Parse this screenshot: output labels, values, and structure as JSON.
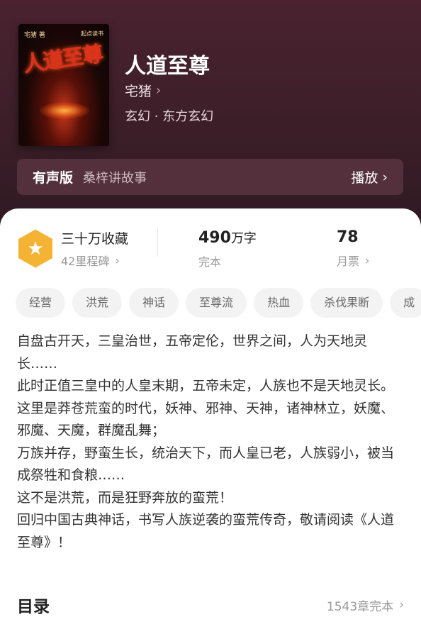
{
  "book": {
    "title": "人道至尊",
    "author": "宅猪",
    "genre": "玄幻 · 东方玄幻",
    "cover": {
      "author_mark": "宅猪 著",
      "publisher_mark": "起点读书",
      "title_art": "人道至尊"
    }
  },
  "audio": {
    "label": "有声版",
    "narrator": "桑梓讲故事",
    "play_label": "播放"
  },
  "stats": {
    "collection": {
      "title": "三十万收藏",
      "sub": "42里程碑"
    },
    "words": {
      "value": "490",
      "unit": "万字",
      "sub": "完本"
    },
    "monthly": {
      "value": "78",
      "sub": "月票"
    }
  },
  "tags": [
    "经营",
    "洪荒",
    "神话",
    "至尊流",
    "热血",
    "杀伐果断",
    "成"
  ],
  "description": [
    "自盘古开天，三皇治世，五帝定伦，世界之间，人为天地灵长……",
    "此时正值三皇中的人皇末期，五帝未定，人族也不是天地灵长。",
    "这里是莽苍荒蛮的时代，妖神、邪神、天神，诸神林立，妖魔、邪魔、天魔，群魔乱舞；",
    "万族并存，野蛮生长，统治天下，而人皇已老，人族弱小，被当成祭牲和食粮……",
    "这不是洪荒，而是狂野奔放的蛮荒！",
    "回归中国古典神话，书写人族逆袭的蛮荒传奇，敬请阅读《人道至尊》！"
  ],
  "toc": {
    "title": "目录",
    "info": "1543章完本"
  },
  "icons": {
    "chevron": "chevron-right-icon",
    "badge": "star-icon"
  },
  "colors": {
    "hero_bg": "#4a2230",
    "audio_bg": "#53303c",
    "badge": "#f5b335"
  }
}
